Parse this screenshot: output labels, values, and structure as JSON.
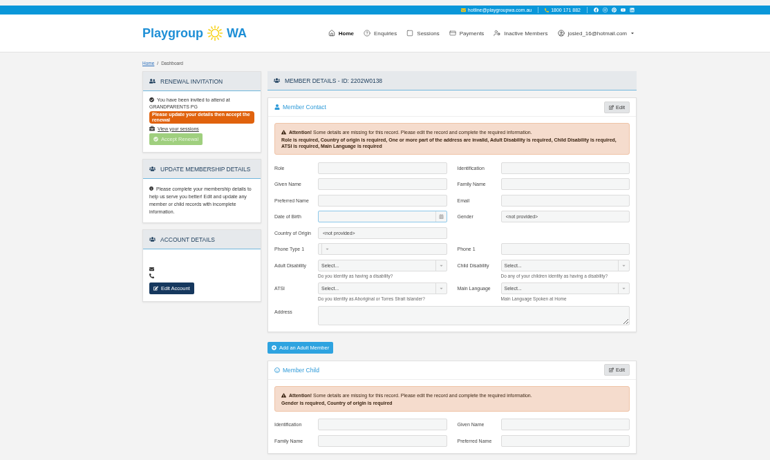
{
  "top_bar": {
    "email": "hotline@playgroupwa.com.au",
    "phone": "1800 171 882"
  },
  "header": {
    "logo": {
      "word": "Playgroup",
      "suffix": "WA"
    },
    "nav": [
      {
        "label": "Home",
        "selected": true
      },
      {
        "label": "Enquiries",
        "selected": false
      },
      {
        "label": "Sessions",
        "selected": false
      },
      {
        "label": "Payments",
        "selected": false
      },
      {
        "label": "Inactive Members",
        "selected": false
      }
    ],
    "user": "josied_16@hotmail.com"
  },
  "breadcrumb": {
    "items": [
      "Home",
      "Dashboard"
    ],
    "separator": "/"
  },
  "renewal": {
    "title": "RENEWAL INVITATION",
    "message": "You have been invited to attend at",
    "group": "GRANDPARENTS PG",
    "badge": "Please update your details then accept the renewal",
    "link": "View your sessions",
    "button": {
      "label": "Accept Renewal",
      "disabled": true
    }
  },
  "update": {
    "title": "UPDATE MEMBERSHIP DETAILS",
    "text": "Please complete your membership details to help us serve you better! Edit and update any member or child records with incomplete information."
  },
  "account": {
    "title": "ACCOUNT DETAILS",
    "button": "Edit Account"
  },
  "member_details": {
    "title": "MEMBER DETAILS - ID: 2202W0138",
    "sections": [
      {
        "title": "Member Contact",
        "kind": "contact",
        "edit": "Edit",
        "alert": {
          "text": "**Attention!** Some details are missing for this record. Please edit the record and complete the required information.",
          "errors": "Role is required, Country of origin is required, One or more part of the address are invalid, Adult Disability is required, Child Disability is required, ATSI is required, Main Language is required"
        },
        "rows": [
          [
            {
              "label": "Role",
              "kind": "text",
              "focused": false
            },
            {
              "label": "Identification",
              "kind": "text",
              "focused": false
            }
          ],
          [
            {
              "label": "Given Name",
              "kind": "text",
              "focused": false
            },
            {
              "label": "Family Name",
              "kind": "text",
              "focused": false
            }
          ],
          [
            {
              "label": "Preferred Name",
              "kind": "text",
              "focused": false
            },
            {
              "label": "Email",
              "kind": "text",
              "focused": false
            }
          ],
          [
            {
              "label": "Date of Birth",
              "kind": "date",
              "focused": true
            },
            {
              "label": "Gender",
              "kind": "text",
              "value": "<not provided>",
              "focused": false
            }
          ],
          [
            {
              "label": "Country of Origin",
              "kind": "text",
              "value": "<not provided>",
              "focused": false
            }
          ],
          [
            {
              "label": "Phone Type 1",
              "kind": "select",
              "focused": false
            },
            {
              "label": "Phone 1",
              "kind": "text",
              "focused": false
            }
          ],
          [
            {
              "label": "Adult Disability",
              "kind": "select",
              "placeholder": "Select...",
              "hint": "Do you identity as having a disability?",
              "focused": false
            },
            {
              "label": "Child Disability",
              "kind": "select",
              "placeholder": "Select...",
              "hint": "Do any of your children identity as having a disability?",
              "focused": false
            }
          ],
          [
            {
              "label": "ATSI",
              "kind": "select",
              "placeholder": "Select...",
              "hint": "Do you identity as Aboriginal or Torres Strait Islander?",
              "focused": false
            },
            {
              "label": "Main Language",
              "kind": "select",
              "placeholder": "Select...",
              "hint": "Main Language Spoken at Home",
              "focused": false
            }
          ],
          [
            {
              "label": "Address",
              "kind": "textarea",
              "focused": false
            }
          ]
        ]
      },
      {
        "title": "Member Child",
        "kind": "child",
        "edit": "Edit",
        "alert": {
          "text": "**Attention!** Some details are missing for this record. Please edit the record and complete the required information.",
          "errors": "Gender is required, Country of origin is required"
        },
        "rows": [
          [
            {
              "label": "Identification",
              "kind": "text",
              "focused": false
            },
            {
              "label": "Given Name",
              "kind": "text",
              "focused": false
            }
          ],
          [
            {
              "label": "Family Name",
              "kind": "text",
              "focused": false
            },
            {
              "label": "Preferred Name",
              "kind": "text",
              "focused": false
            }
          ]
        ]
      }
    ],
    "add_button": "Add an Adult Member"
  }
}
